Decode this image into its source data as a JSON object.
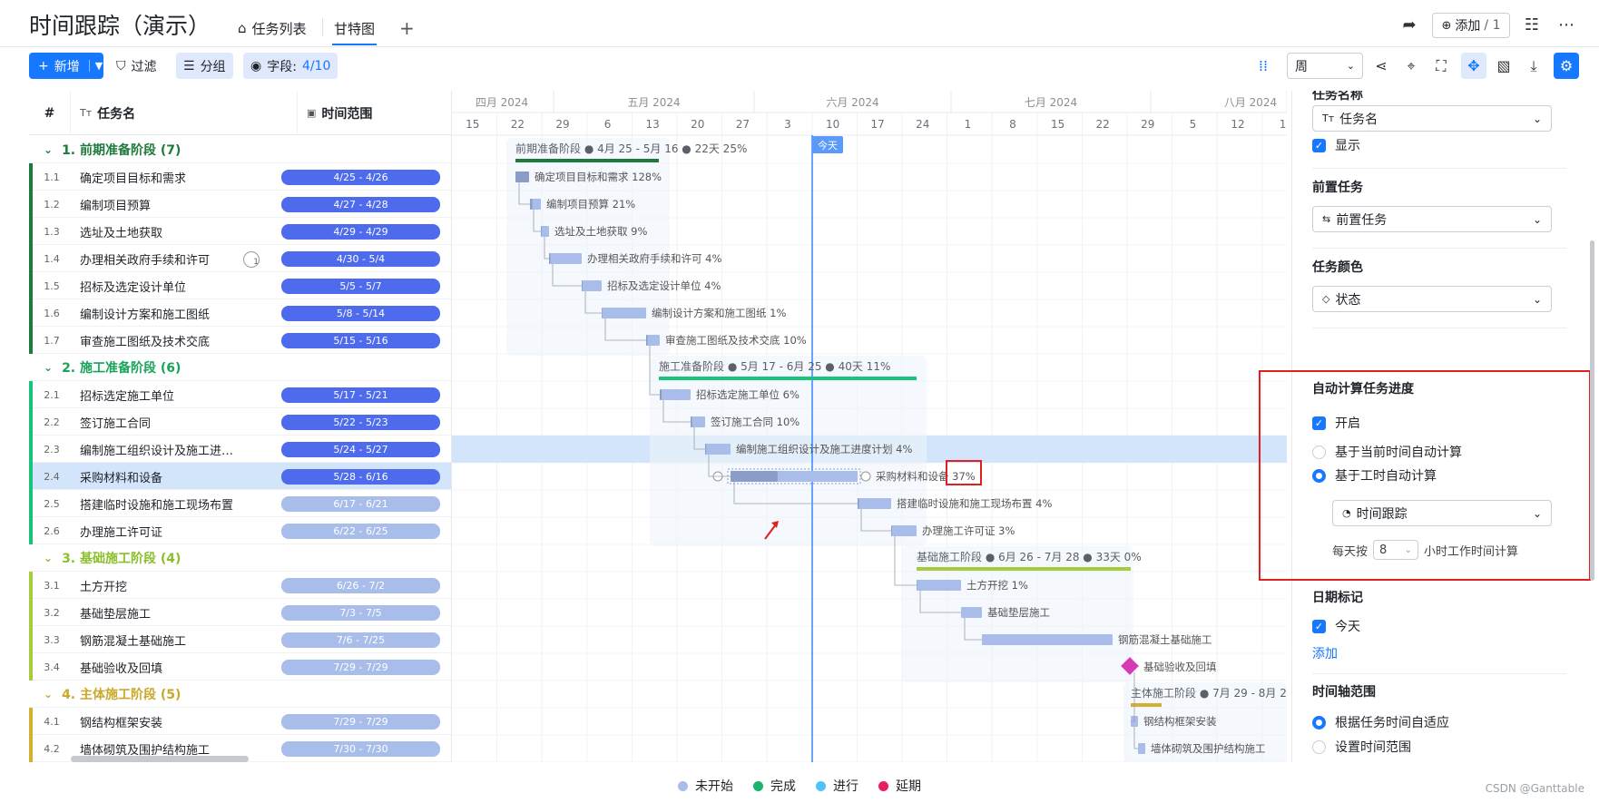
{
  "header": {
    "title": "时间跟踪（演示）",
    "tabs": [
      {
        "label": "任务列表",
        "active": false
      },
      {
        "label": "甘特图",
        "active": true
      }
    ],
    "add_member": {
      "label": "添加",
      "count": "/ 1"
    }
  },
  "toolbar": {
    "new_label": "新增",
    "filter_label": "过滤",
    "group_label": "分组",
    "fields_label": "字段:",
    "fields_count": "4/10",
    "period": "周"
  },
  "grid": {
    "col_index": "#",
    "col_name": "任务名",
    "col_range": "时间范围",
    "groups": [
      {
        "label": "1. 前期准备阶段 (7)",
        "color": "#1e7a3c",
        "accent": "#1e7a3c",
        "rows": [
          {
            "idx": "1.1",
            "name": "确定项目目标和需求",
            "range": "4/25 - 4/26",
            "tone": "dark"
          },
          {
            "idx": "1.2",
            "name": "编制项目预算",
            "range": "4/27 - 4/28",
            "tone": "dark"
          },
          {
            "idx": "1.3",
            "name": "选址及土地获取",
            "range": "4/29 - 4/29",
            "tone": "dark"
          },
          {
            "idx": "1.4",
            "name": "办理相关政府手续和许可",
            "range": "4/30 - 5/4",
            "tone": "dark",
            "badge": "1"
          },
          {
            "idx": "1.5",
            "name": "招标及选定设计单位",
            "range": "5/5 - 5/7",
            "tone": "dark"
          },
          {
            "idx": "1.6",
            "name": "编制设计方案和施工图纸",
            "range": "5/8 - 5/14",
            "tone": "dark"
          },
          {
            "idx": "1.7",
            "name": "审查施工图纸及技术交底",
            "range": "5/15 - 5/16",
            "tone": "dark"
          }
        ]
      },
      {
        "label": "2. 施工准备阶段 (6)",
        "color": "#19a35a",
        "accent": "#19c37a",
        "rows": [
          {
            "idx": "2.1",
            "name": "招标选定施工单位",
            "range": "5/17 - 5/21",
            "tone": "dark"
          },
          {
            "idx": "2.2",
            "name": "签订施工合同",
            "range": "5/22 - 5/23",
            "tone": "dark"
          },
          {
            "idx": "2.3",
            "name": "编制施工组织设计及施工进…",
            "range": "5/24 - 5/27",
            "tone": "dark"
          },
          {
            "idx": "2.4",
            "name": "采购材料和设备",
            "range": "5/28 - 6/16",
            "tone": "dark",
            "selected": true
          },
          {
            "idx": "2.5",
            "name": "搭建临时设施和施工现场布置",
            "range": "6/17 - 6/21",
            "tone": "light"
          },
          {
            "idx": "2.6",
            "name": "办理施工许可证",
            "range": "6/22 - 6/25",
            "tone": "light"
          }
        ]
      },
      {
        "label": "3. 基础施工阶段 (4)",
        "color": "#8cbf2a",
        "accent": "#a4cc3c",
        "rows": [
          {
            "idx": "3.1",
            "name": "土方开挖",
            "range": "6/26 - 7/2",
            "tone": "light"
          },
          {
            "idx": "3.2",
            "name": "基础垫层施工",
            "range": "7/3 - 7/5",
            "tone": "light"
          },
          {
            "idx": "3.3",
            "name": "钢筋混凝土基础施工",
            "range": "7/6 - 7/25",
            "tone": "light"
          },
          {
            "idx": "3.4",
            "name": "基础验收及回填",
            "range": "7/29 - 7/29",
            "tone": "light"
          }
        ]
      },
      {
        "label": "4. 主体施工阶段 (5)",
        "color": "#c9a82a",
        "accent": "#d4b030",
        "rows": [
          {
            "idx": "4.1",
            "name": "钢结构框架安装",
            "range": "7/29 - 7/29",
            "tone": "light"
          },
          {
            "idx": "4.2",
            "name": "墙体砌筑及围护结构施工",
            "range": "7/30 - 7/30",
            "tone": "light"
          }
        ]
      }
    ]
  },
  "timeline": {
    "months": [
      "四月 2024",
      "五月 2024",
      "六月 2024",
      "七月 2024",
      "八月 2024"
    ],
    "weeks": [
      "15",
      "22",
      "29",
      "6",
      "13",
      "20",
      "27",
      "3",
      "10",
      "17",
      "24",
      "1",
      "8",
      "15",
      "22",
      "29",
      "5",
      "12",
      "1"
    ],
    "today_label": "今天",
    "group_summaries": [
      {
        "text": "前期准备阶段 ● 4月 25 - 5月 16 ● 22天 25%"
      },
      {
        "text": "施工准备阶段 ● 5月 17 - 6月 25 ● 40天 11%"
      },
      {
        "text": "基础施工阶段 ● 6月 26 - 7月 28 ● 33天 0%"
      },
      {
        "text": "主体施工阶段 ● 7月 29 - 8月 2"
      }
    ],
    "bar_labels": [
      "确定项目目标和需求 128%",
      "编制项目预算 21%",
      "选址及土地获取 9%",
      "办理相关政府手续和许可 4%",
      "招标及选定设计单位 4%",
      "编制设计方案和施工图纸 1%",
      "审查施工图纸及技术交底 10%",
      "招标选定施工单位 6%",
      "签订施工合同 10%",
      "编制施工组织设计及施工进度计划 4%",
      "采购材料和设备 37%",
      "搭建临时设施和施工现场布置 4%",
      "办理施工许可证 3%",
      "土方开挖 1%",
      "基础垫层施工",
      "钢筋混凝土基础施工",
      "基础验收及回填",
      "钢结构框架安装",
      "墙体砌筑及围护结构施工"
    ]
  },
  "panel": {
    "task_name_section": "任务名称",
    "task_name_value": "任务名",
    "show_label": "显示",
    "predecessor_section": "前置任务",
    "predecessor_value": "前置任务",
    "color_section": "任务颜色",
    "color_value": "状态",
    "auto_section": "自动计算任务进度",
    "auto_enable": "开启",
    "auto_opt1": "基于当前时间自动计算",
    "auto_opt2": "基于工时自动计算",
    "auto_field": "时间跟踪",
    "hours_prefix": "每天按",
    "hours_value": "8",
    "hours_suffix": "小时工作时间计算",
    "date_marks_section": "日期标记",
    "date_today": "今天",
    "date_add": "添加",
    "range_section": "时间轴范围",
    "range_opt1": "根据任务时间自适应",
    "range_opt2": "设置时间范围"
  },
  "legend": [
    {
      "label": "未开始",
      "color": "#a9bdea"
    },
    {
      "label": "完成",
      "color": "#19b36b"
    },
    {
      "label": "进行",
      "color": "#4fc3f7"
    },
    {
      "label": "延期",
      "color": "#e91e63"
    }
  ],
  "watermark": "CSDN @Ganttable",
  "colors": {
    "accent": "#1677ff",
    "bar_dark": "#4f6bed",
    "bar_light": "#a9bdea",
    "highlight_red": "#e02020"
  }
}
